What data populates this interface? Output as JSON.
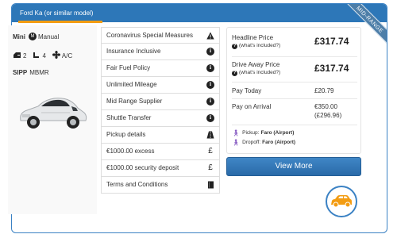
{
  "header": {
    "title": "Ford Ka (or similar model)",
    "ribbon": "MID-RANGE"
  },
  "car": {
    "category": "Mini",
    "transmission": "Manual",
    "doors": "2",
    "seats": "4",
    "aircon": "A/C",
    "sipp_label": "SIPP",
    "sipp_code": "MBMR"
  },
  "features": [
    {
      "label": "Coronavirus Special Measures",
      "icon": "warning-icon"
    },
    {
      "label": "Insurance Inclusive",
      "icon": "info-icon"
    },
    {
      "label": "Fair Fuel Policy",
      "icon": "info-icon"
    },
    {
      "label": "Unlimited Mileage",
      "icon": "info-icon"
    },
    {
      "label": "Mid Range Supplier",
      "icon": "info-icon"
    },
    {
      "label": "Shuttle Transfer",
      "icon": "info-icon"
    },
    {
      "label": "Pickup details",
      "icon": "road-icon"
    },
    {
      "label": "€1000.00 excess",
      "icon": "pound-icon"
    },
    {
      "label": "€1000.00 security deposit",
      "icon": "pound-icon"
    },
    {
      "label": "Terms and Conditions",
      "icon": "book-icon"
    }
  ],
  "pricing": {
    "headline_label": "Headline Price",
    "headline_price": "£317.74",
    "whats_included": "(what's included?)",
    "drive_away_label": "Drive Away Price",
    "drive_away_price": "£317.74",
    "pay_today_label": "Pay Today",
    "pay_today_value": "£20.79",
    "pay_on_arrival_label": "Pay on Arrival",
    "pay_on_arrival_value": "€350.00",
    "pay_on_arrival_alt": "(£296.96)",
    "pickup_label": "Pickup:",
    "pickup_location": "Faro (Airport)",
    "dropoff_label": "Dropoff:",
    "dropoff_location": "Faro (Airport)"
  },
  "actions": {
    "view_more": "View More"
  },
  "colors": {
    "header": "#2d77b8",
    "accent": "#f39c12",
    "badge_car": "#f39c12"
  }
}
